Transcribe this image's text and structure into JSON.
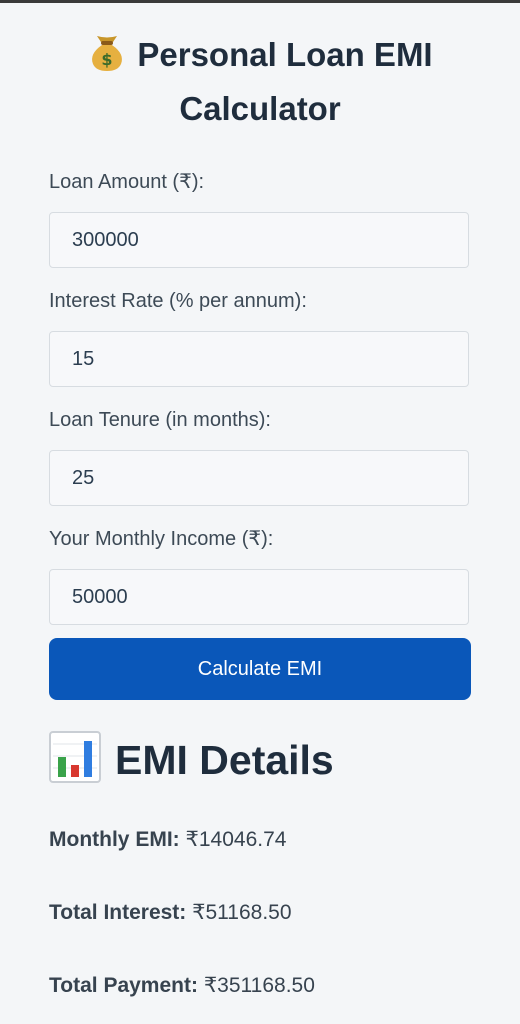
{
  "app": {
    "title": "Personal Loan EMI Calculator",
    "title_icon": "money-bag-icon"
  },
  "form": {
    "loan_amount": {
      "label": "Loan Amount (₹):",
      "value": "300000"
    },
    "interest_rate": {
      "label": "Interest Rate (% per annum):",
      "value": "15"
    },
    "tenure": {
      "label": "Loan Tenure (in months):",
      "value": "25"
    },
    "income": {
      "label": "Your Monthly Income (₹):",
      "value": "50000"
    },
    "calculate_label": "Calculate EMI"
  },
  "results": {
    "title": "EMI Details",
    "title_icon": "bar-chart-icon",
    "monthly_emi": {
      "label": "Monthly EMI:",
      "value": "₹14046.74"
    },
    "total_interest": {
      "label": "Total Interest:",
      "value": "₹51168.50"
    },
    "total_payment": {
      "label": "Total Payment:",
      "value": "₹351168.50"
    }
  },
  "colors": {
    "button": "#0a57b9",
    "background": "#f4f6f8",
    "heading": "#1f2d3d"
  }
}
